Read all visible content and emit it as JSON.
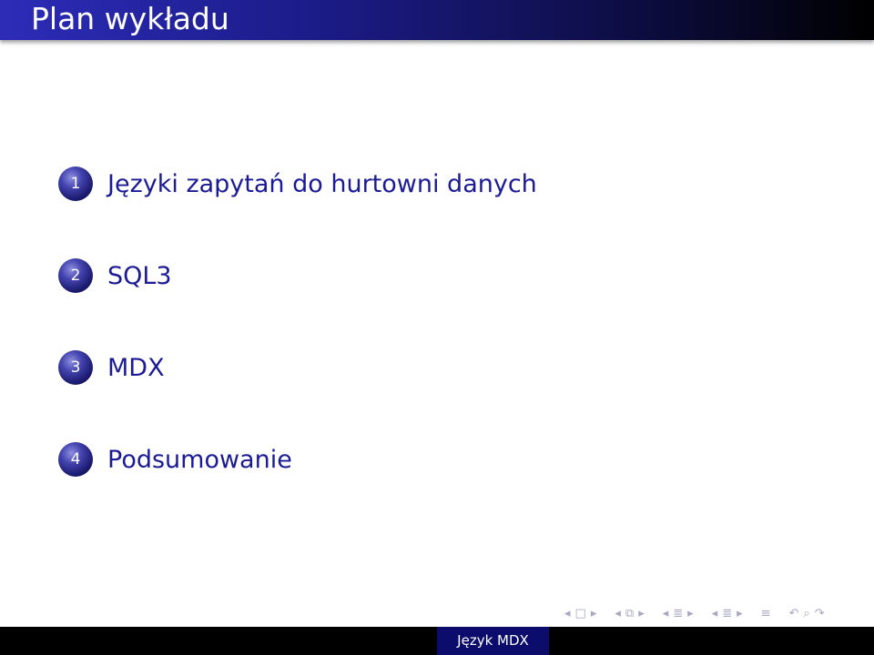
{
  "frame": {
    "title": "Plan wykładu"
  },
  "toc": {
    "items": [
      {
        "number": "1",
        "label": "Języki zapytań do hurtowni danych"
      },
      {
        "number": "2",
        "label": "SQL3"
      },
      {
        "number": "3",
        "label": "MDX"
      },
      {
        "number": "4",
        "label": "Podsumowanie"
      }
    ]
  },
  "navigation": {
    "icons": [
      "arrow-left-icon",
      "frame-icon",
      "arrow-right-icon",
      "arrow-left-icon",
      "subsection-icon",
      "arrow-right-icon",
      "arrow-left-icon",
      "section-icon",
      "arrow-right-icon",
      "arrow-left-icon",
      "section-icon",
      "arrow-right-icon",
      "align-icon",
      "undo-icon",
      "search-icon",
      "redo-icon"
    ]
  },
  "footer": {
    "title": "Język MDX"
  },
  "colors": {
    "title_bar_start": "#2c2cb8",
    "title_bar_end": "#000000",
    "toc_text": "#1b1b96",
    "footer_box": "#0c0c6c",
    "nav_icons": "#a8a8c4"
  }
}
